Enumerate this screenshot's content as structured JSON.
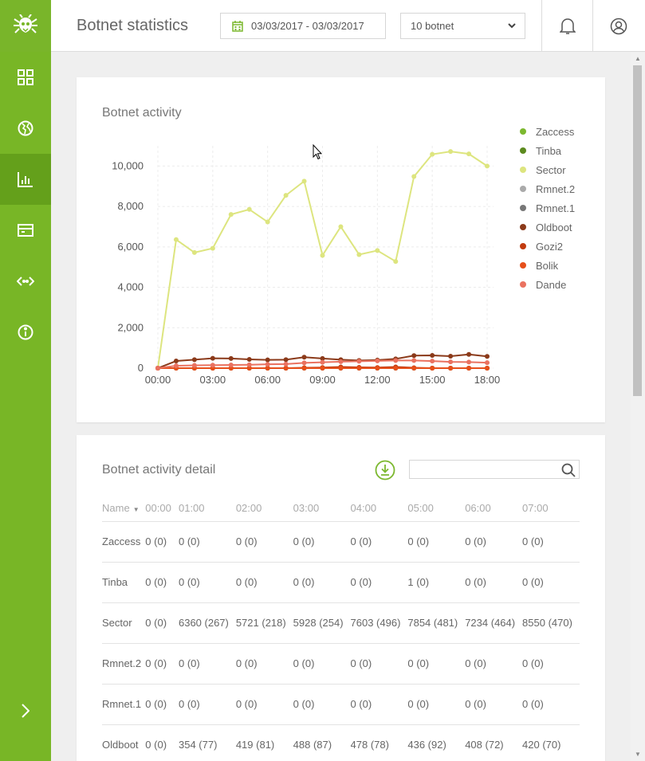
{
  "header": {
    "title": "Botnet statistics",
    "date_range": "03/03/2017 - 03/03/2017",
    "botnet_select": "10 botnet"
  },
  "sidebar": {
    "items": [
      {
        "icon": "dashboard-icon"
      },
      {
        "icon": "globe-icon"
      },
      {
        "icon": "bar-chart-icon"
      },
      {
        "icon": "card-icon"
      },
      {
        "icon": "code-icon"
      },
      {
        "icon": "info-icon"
      }
    ],
    "active_index": 2,
    "expand_icon": "chevron-right-icon"
  },
  "activity_card": {
    "title": "Botnet activity"
  },
  "chart_data": {
    "type": "line",
    "title": "Botnet activity",
    "xlabel": "",
    "ylabel": "",
    "x": [
      "00:00",
      "01:00",
      "02:00",
      "03:00",
      "04:00",
      "05:00",
      "06:00",
      "07:00",
      "08:00",
      "09:00",
      "10:00",
      "11:00",
      "12:00",
      "13:00",
      "14:00",
      "15:00",
      "16:00",
      "17:00",
      "18:00"
    ],
    "x_ticks": [
      "00:00",
      "03:00",
      "06:00",
      "09:00",
      "12:00",
      "15:00",
      "18:00"
    ],
    "y_ticks": [
      "0",
      "2,000",
      "4,000",
      "6,000",
      "8,000",
      "10,000"
    ],
    "ylim": [
      0,
      11000
    ],
    "legend_position": "right",
    "grid": true,
    "series": [
      {
        "name": "Zaccess",
        "color": "#7cb82f",
        "values": [
          0,
          0,
          0,
          0,
          0,
          0,
          0,
          0,
          0,
          0,
          0,
          0,
          0,
          0,
          0,
          0,
          0,
          0,
          0
        ]
      },
      {
        "name": "Tinba",
        "color": "#5c8a1e",
        "values": [
          0,
          0,
          0,
          0,
          0,
          1,
          0,
          0,
          0,
          0,
          0,
          0,
          0,
          0,
          0,
          0,
          0,
          0,
          0
        ]
      },
      {
        "name": "Sector",
        "color": "#dde57f",
        "values": [
          0,
          6360,
          5721,
          5928,
          7603,
          7854,
          7234,
          8550,
          9250,
          5580,
          7000,
          5620,
          5820,
          5280,
          9480,
          10580,
          10720,
          10600,
          10000
        ]
      },
      {
        "name": "Rmnet.2",
        "color": "#aaaaaa",
        "values": [
          0,
          0,
          0,
          0,
          0,
          0,
          0,
          0,
          0,
          0,
          0,
          0,
          0,
          0,
          0,
          0,
          0,
          0,
          0
        ]
      },
      {
        "name": "Rmnet.1",
        "color": "#777777",
        "values": [
          0,
          0,
          0,
          0,
          0,
          0,
          0,
          0,
          0,
          0,
          0,
          0,
          0,
          0,
          0,
          0,
          0,
          0,
          0
        ]
      },
      {
        "name": "Oldboot",
        "color": "#8b3a1a",
        "values": [
          0,
          354,
          419,
          488,
          478,
          436,
          408,
          420,
          540,
          480,
          420,
          380,
          400,
          460,
          620,
          630,
          590,
          680,
          580
        ]
      },
      {
        "name": "Gozi2",
        "color": "#c23b0f",
        "values": [
          0,
          0,
          0,
          0,
          0,
          0,
          0,
          0,
          20,
          30,
          60,
          40,
          30,
          60,
          20,
          0,
          0,
          0,
          0
        ]
      },
      {
        "name": "Bolik",
        "color": "#e64f1a",
        "values": [
          0,
          0,
          0,
          0,
          0,
          0,
          0,
          0,
          0,
          0,
          0,
          0,
          0,
          0,
          0,
          0,
          0,
          0,
          0
        ]
      },
      {
        "name": "Dande",
        "color": "#ea7260",
        "values": [
          0,
          120,
          140,
          150,
          160,
          170,
          190,
          200,
          260,
          290,
          320,
          340,
          360,
          380,
          380,
          350,
          310,
          300,
          270
        ]
      }
    ]
  },
  "detail_card": {
    "title": "Botnet activity detail",
    "download_icon": "download-icon",
    "search_icon": "search-icon",
    "search_value": "",
    "columns": [
      "Name",
      "00:00",
      "01:00",
      "02:00",
      "03:00",
      "04:00",
      "05:00",
      "06:00",
      "07:00"
    ],
    "rows": [
      {
        "name": "Zaccess",
        "cells": [
          "0 (0)",
          "0 (0)",
          "0 (0)",
          "0 (0)",
          "0 (0)",
          "0 (0)",
          "0 (0)",
          "0 (0)"
        ]
      },
      {
        "name": "Tinba",
        "cells": [
          "0 (0)",
          "0 (0)",
          "0 (0)",
          "0 (0)",
          "0 (0)",
          "1 (0)",
          "0 (0)",
          "0 (0)"
        ]
      },
      {
        "name": "Sector",
        "cells": [
          "0 (0)",
          "6360 (267)",
          "5721 (218)",
          "5928 (254)",
          "7603 (496)",
          "7854 (481)",
          "7234 (464)",
          "8550 (470)"
        ]
      },
      {
        "name": "Rmnet.2",
        "cells": [
          "0 (0)",
          "0 (0)",
          "0 (0)",
          "0 (0)",
          "0 (0)",
          "0 (0)",
          "0 (0)",
          "0 (0)"
        ]
      },
      {
        "name": "Rmnet.1",
        "cells": [
          "0 (0)",
          "0 (0)",
          "0 (0)",
          "0 (0)",
          "0 (0)",
          "0 (0)",
          "0 (0)",
          "0 (0)"
        ]
      },
      {
        "name": "Oldboot",
        "cells": [
          "0 (0)",
          "354 (77)",
          "419 (81)",
          "488 (87)",
          "478 (78)",
          "436 (92)",
          "408 (72)",
          "420 (70)"
        ]
      }
    ]
  },
  "colors": {
    "sidebar": "#78b626",
    "sidebar_active": "#64a01b",
    "accent": "#7cb82f"
  }
}
